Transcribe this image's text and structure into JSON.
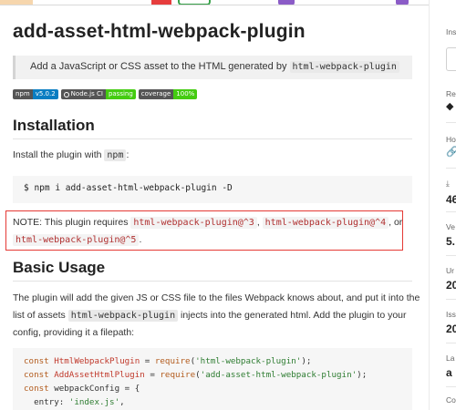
{
  "topbar": {
    "segments": [
      "orange",
      "white",
      "red",
      "green-tab",
      "purple",
      "white",
      "purple"
    ]
  },
  "main": {
    "title": "add-asset-html-webpack-plugin",
    "description": {
      "before": "Add a JavaScript or CSS asset to the HTML generated by ",
      "code": "html-webpack-plugin"
    },
    "badges": [
      {
        "label": "npm",
        "value": "v5.0.2",
        "color": "#0a7ec2"
      },
      {
        "label": "Node.js CI",
        "value": "passing",
        "color": "#44cc11"
      },
      {
        "label": "coverage",
        "value": "100%",
        "color": "#44cc11"
      }
    ],
    "installation": {
      "heading": "Installation",
      "text_before": "Install the plugin with ",
      "text_code": "npm",
      "text_after": ":",
      "command": "$ npm i add-asset-html-webpack-plugin -D"
    },
    "note": {
      "line1_prefix": "NOTE: This plugin requires ",
      "code1": "html-webpack-plugin@^3",
      "sep1": ", ",
      "code2": "html-webpack-plugin@^4",
      "sep2": ", or",
      "code3": "html-webpack-plugin@^5",
      "end": "."
    },
    "basic_usage": {
      "heading": "Basic Usage",
      "line1": "The plugin will add the given JS or CSS file to the files Webpack knows about, and put it into the",
      "line2_before": "list of assets ",
      "line2_code": "html-webpack-plugin",
      "line2_after": " injects into the generated html. Add the plugin to your",
      "line3": "config, providing it a filepath:"
    },
    "code": {
      "l1_kw": "const ",
      "l1_name": "HtmlWebpackPlugin",
      "l1_eq": " = ",
      "l1_fn": "require",
      "l1_open": "(",
      "l1_str": "'html-webpack-plugin'",
      "l1_close": ");",
      "l2_kw": "const ",
      "l2_name": "AddAssetHtmlPlugin",
      "l2_eq": " = ",
      "l2_fn": "require",
      "l2_open": "(",
      "l2_str": "'add-asset-html-webpack-plugin'",
      "l2_close": ");",
      "l3_kw": "const ",
      "l3_rest": "webpackConfig = {",
      "l4_key": "  entry: ",
      "l4_str": "'index.js'",
      "l4_end": ","
    }
  },
  "sidebar": {
    "install_label": "Ins",
    "repo_label": "Re",
    "repo_icon": "diamond-icon",
    "homepage_label": "Ho",
    "homepage_icon": "link-icon",
    "downloads_label": "⤓",
    "downloads_value": "46",
    "version_label": "Ve",
    "version_value": "5.",
    "license_label": "Ur",
    "license_value": "20",
    "issues_label": "Iss",
    "issues_value": "20",
    "last_label": "La",
    "last_value": "a",
    "collab_label": "Co"
  }
}
